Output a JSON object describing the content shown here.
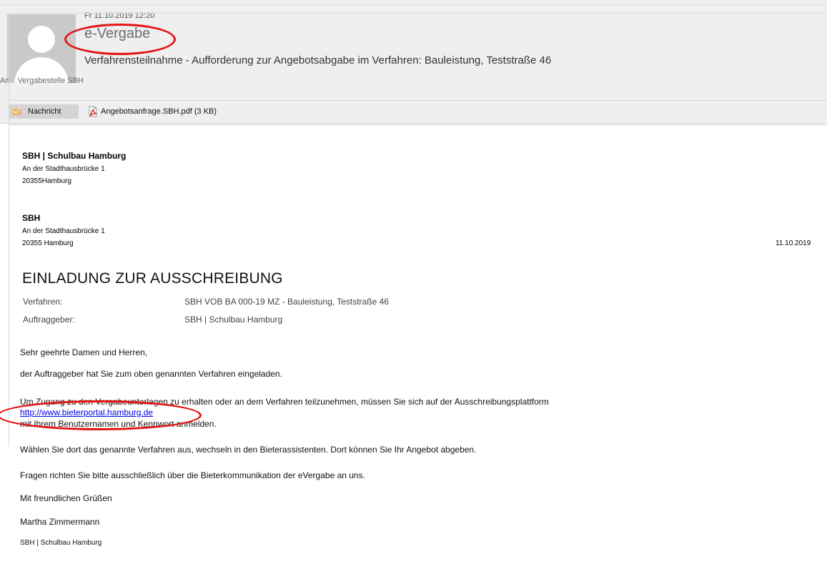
{
  "header": {
    "date": "Fr 11.10.2019 12:20",
    "sender": "e-Vergabe",
    "subject": "Verfahrensteilnahme - Aufforderung zur Angebotsabgabe im Verfahren: Bauleistung, Teststraße 46",
    "to_label": "An",
    "to_value": "Vergabestelle SBH",
    "tab_message": "Nachricht",
    "attachment": "Angebotsanfrage.SBH.pdf (3 KB)"
  },
  "body": {
    "sender_block": {
      "name": "SBH | Schulbau Hamburg",
      "street": "An der Stadthausbrücke 1",
      "city": "20355Hamburg"
    },
    "recipient_block": {
      "name": "SBH",
      "street": "An der Stadthausbrücke 1",
      "city": "20355 Hamburg",
      "date": "11.10.2019"
    },
    "heading": "EINLADUNG ZUR AUSSCHREIBUNG",
    "meta": [
      {
        "label": "Verfahren:",
        "value": "SBH VOB BA 000-19 MZ - Bauleistung, Teststraße 46"
      },
      {
        "label": "Auftraggeber:",
        "value": "SBH | Schulbau Hamburg"
      }
    ],
    "greeting": "Sehr geehrte Damen und Herren,",
    "p1": "der Auftraggeber hat Sie zum oben genannten Verfahren eingeladen.",
    "p2_line1": "Um Zugang zu den Vergabeunterlagen zu erhalten oder an dem Verfahren teilzunehmen, müssen Sie sich auf der Ausschreibungsplattform",
    "p2_link": "http://www.bieterportal.hamburg.de",
    "p2_line3": "mit Ihrem Benutzernamen und Kennwort anmelden.",
    "p3": "Wählen Sie dort das genannte Verfahren aus, wechseln in den Bieterassistenten. Dort können Sie Ihr Angebot abgeben.",
    "p4": "Fragen richten Sie bitte ausschließlich über die Bieterkommunikation der eVergabe an uns.",
    "closing": "Mit freundlichen Grüßen",
    "signer": "Martha Zimmermann",
    "signature_org": "SBH | Schulbau Hamburg"
  },
  "annotations": {
    "color": "#e31414"
  },
  "icons": {
    "avatar": "person-silhouette-icon",
    "message_tab": "envelope-icon",
    "attachment": "pdf-file-icon"
  }
}
